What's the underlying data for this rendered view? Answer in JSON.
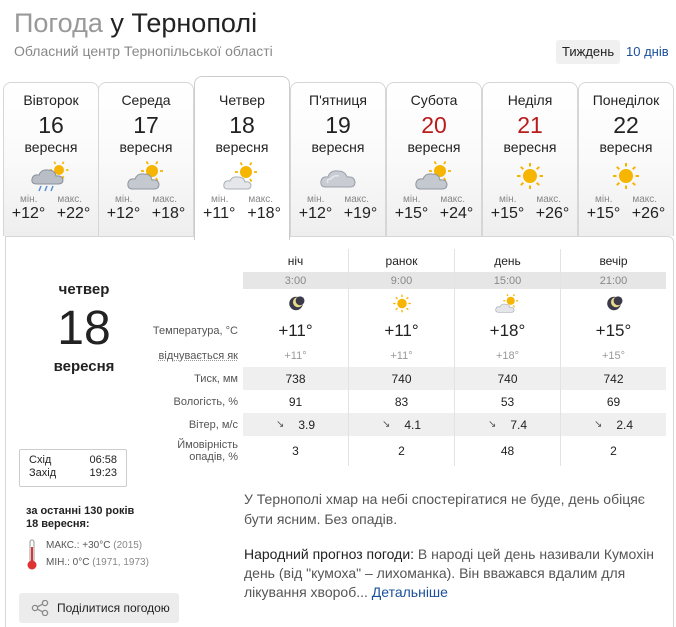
{
  "header": {
    "title_light": "Погода",
    "title_main": " у Тернополі",
    "subtitle": "Обласний центр Тернопільської області",
    "period_week": "Тиждень",
    "period_10": "10 днів"
  },
  "days": [
    {
      "name": "Вівторок",
      "num": "16",
      "month": "вересня",
      "icon": "cloud-rain-sun-icon",
      "min_label": "мін.",
      "max_label": "макс.",
      "min": "+12°",
      "max": "+22°",
      "weekend": false
    },
    {
      "name": "Середа",
      "num": "17",
      "month": "вересня",
      "icon": "cloud-sun-icon",
      "min_label": "мін.",
      "max_label": "макс.",
      "min": "+12°",
      "max": "+18°",
      "weekend": false
    },
    {
      "name": "Четвер",
      "num": "18",
      "month": "вересня",
      "icon": "sun-cloud-icon",
      "min_label": "мін.",
      "max_label": "макс.",
      "min": "+11°",
      "max": "+18°",
      "weekend": false
    },
    {
      "name": "П'ятниця",
      "num": "19",
      "month": "вересня",
      "icon": "cloud-icon",
      "min_label": "мін.",
      "max_label": "макс.",
      "min": "+12°",
      "max": "+19°",
      "weekend": false
    },
    {
      "name": "Субота",
      "num": "20",
      "month": "вересня",
      "icon": "cloud-sun-icon",
      "min_label": "мін.",
      "max_label": "макс.",
      "min": "+15°",
      "max": "+24°",
      "weekend": true
    },
    {
      "name": "Неділя",
      "num": "21",
      "month": "вересня",
      "icon": "sun-icon",
      "min_label": "мін.",
      "max_label": "макс.",
      "min": "+15°",
      "max": "+26°",
      "weekend": true
    },
    {
      "name": "Понеділок",
      "num": "22",
      "month": "вересня",
      "icon": "sun-icon",
      "min_label": "мін.",
      "max_label": "макс.",
      "min": "+15°",
      "max": "+26°",
      "weekend": false
    }
  ],
  "selected": {
    "weekday": "четвер",
    "num": "18",
    "month": "вересня"
  },
  "sun": {
    "rise_label": "Схід",
    "rise": "06:58",
    "set_label": "Захід",
    "set": "19:23"
  },
  "history": {
    "title1": "за останні 130 років",
    "title2": "18 вересня:",
    "max_label": "МАКС.: +30°C",
    "max_year": "(2015)",
    "min_label": "МІН.: 0°C",
    "min_year": "(1971, 1973)"
  },
  "share": {
    "label": "Поділитися погодою"
  },
  "table": {
    "periods": [
      "ніч",
      "ранок",
      "день",
      "вечір"
    ],
    "times": [
      "3:00",
      "9:00",
      "15:00",
      "21:00"
    ],
    "icons": [
      "moon-icon",
      "sun-icon",
      "sun-cloud-icon",
      "moon-icon"
    ],
    "temp_label": "Температура, °C",
    "temps": [
      "+11°",
      "+11°",
      "+18°",
      "+15°"
    ],
    "feels_label": "відчувається як",
    "feels": [
      "+11°",
      "+11°",
      "+18°",
      "+15°"
    ],
    "pressure_label": "Тиск, мм",
    "pressure": [
      "738",
      "740",
      "740",
      "742"
    ],
    "humidity_label": "Вологість, %",
    "humidity": [
      "91",
      "83",
      "53",
      "69"
    ],
    "wind_label": "Вітер, м/с",
    "wind_arrow": "↘",
    "wind": [
      "3.9",
      "4.1",
      "7.4",
      "2.4"
    ],
    "precip_label1": "Ймовірність",
    "precip_label2": "опадів, %",
    "precip": [
      "3",
      "2",
      "48",
      "2"
    ]
  },
  "description": "У Тернополі хмар на небі спостерігатися не буде, день обіцяє бути ясним. Без опадів.",
  "folk": {
    "label": "Народний прогноз погоди:",
    "text": " В народі цей день називали Кумохін день (від \"кумоха\" – лихоманка). Він вважався вдалим для лікування хвороб...",
    "link": " Детальніше"
  },
  "colors": {
    "weekend": "#b81c1c",
    "link": "#1a4f9c",
    "sun": "#f5b500"
  }
}
